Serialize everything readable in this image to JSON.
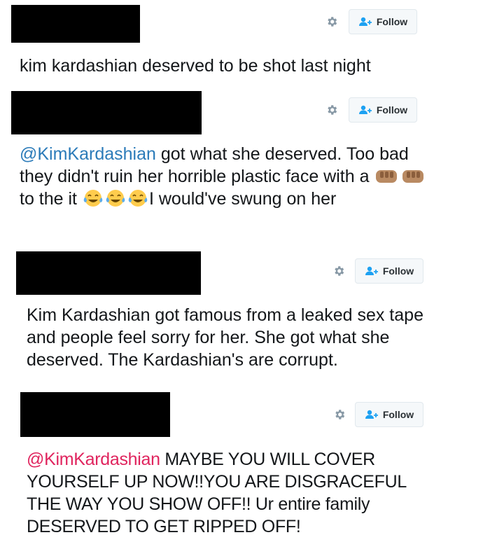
{
  "follow_label": "Follow",
  "tweets": [
    {
      "text": "kim kardashian deserved to be shot last night"
    },
    {
      "mention": "@KimKardashian",
      "text_1": " got what she deserved. Too bad they didn't ruin her horrible plastic face with a ",
      "text_2": " to the it ",
      "text_3": "I would've swung on her",
      "emoji": [
        "fist-bump-emoji",
        "fist-bump-emoji",
        "tears-of-joy-emoji",
        "tears-of-joy-emoji",
        "tears-of-joy-emoji"
      ]
    },
    {
      "text": "Kim Kardashian got famous from a leaked sex tape and people feel sorry for her. She got what she deserved. The Kardashian's are corrupt."
    },
    {
      "mention": "@KimKardashian",
      "text": " MAYBE YOU WILL COVER YOURSELF UP NOW!!YOU ARE DISGRACEFUL THE WAY YOU SHOW OFF!! Ur entire family DESERVED TO GET RIPPED OFF!"
    }
  ],
  "colors": {
    "mention_blue": "#2b7bb9",
    "mention_red": "#e0245e",
    "follow_icon": "#1da1f2",
    "redaction": "#000000"
  },
  "icons": [
    "gear-icon",
    "follow-user-icon"
  ]
}
